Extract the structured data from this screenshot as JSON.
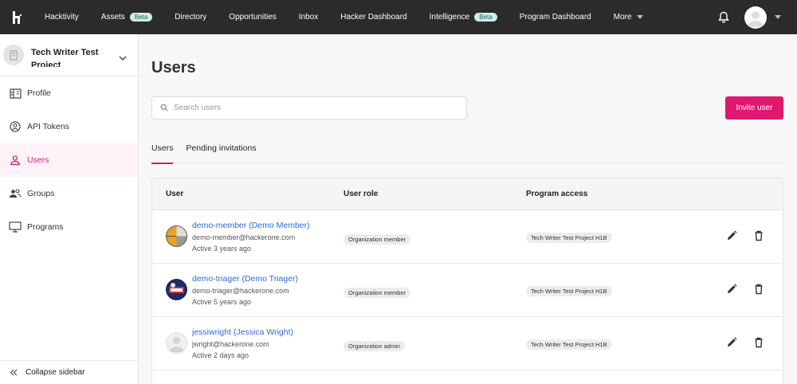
{
  "nav": {
    "items": [
      {
        "label": "Hacktivity"
      },
      {
        "label": "Assets",
        "badge": "Beta"
      },
      {
        "label": "Directory"
      },
      {
        "label": "Opportunities"
      },
      {
        "label": "Inbox"
      },
      {
        "label": "Hacker Dashboard"
      },
      {
        "label": "Intelligence",
        "badge": "Beta"
      },
      {
        "label": "Program Dashboard"
      },
      {
        "label": "More"
      }
    ]
  },
  "sidebar": {
    "org_name": "Tech Writer Test Project",
    "items": [
      {
        "label": "Profile",
        "icon": "building-icon"
      },
      {
        "label": "API Tokens",
        "icon": "user-circle-icon"
      },
      {
        "label": "Users",
        "icon": "user-icon",
        "active": true
      },
      {
        "label": "Groups",
        "icon": "users-icon"
      },
      {
        "label": "Programs",
        "icon": "monitor-icon"
      }
    ],
    "collapse_label": "Collapse sidebar"
  },
  "main": {
    "title": "Users",
    "search_placeholder": "Search users",
    "invite_label": "Invite user",
    "tabs": [
      {
        "label": "Users",
        "active": true
      },
      {
        "label": "Pending invitations"
      }
    ],
    "table": {
      "headers": [
        "User",
        "User role",
        "Program access"
      ],
      "rows": [
        {
          "name": "demo-member (Demo Member)",
          "email": "demo-member@hackerone.com",
          "active": "Active 3 years ago",
          "role": "Organization member",
          "program": "Tech Writer Test Project H1B"
        },
        {
          "name": "demo-triager (Demo Triager)",
          "email": "demo-triager@hackerone.com",
          "active": "Active 5 years ago",
          "role": "Organization member",
          "program": "Tech Writer Test Project H1B"
        },
        {
          "name": "jessiwright (Jessica Wright)",
          "email": "jwright@hackerone.com",
          "active": "Active 2 days ago",
          "role": "Organization admin",
          "program": "Tech Writer Test Project H1B"
        }
      ]
    }
  },
  "colors": {
    "accent": "#e0176e",
    "nav_bg": "#2b2b2b",
    "link": "#2f6ad9"
  }
}
